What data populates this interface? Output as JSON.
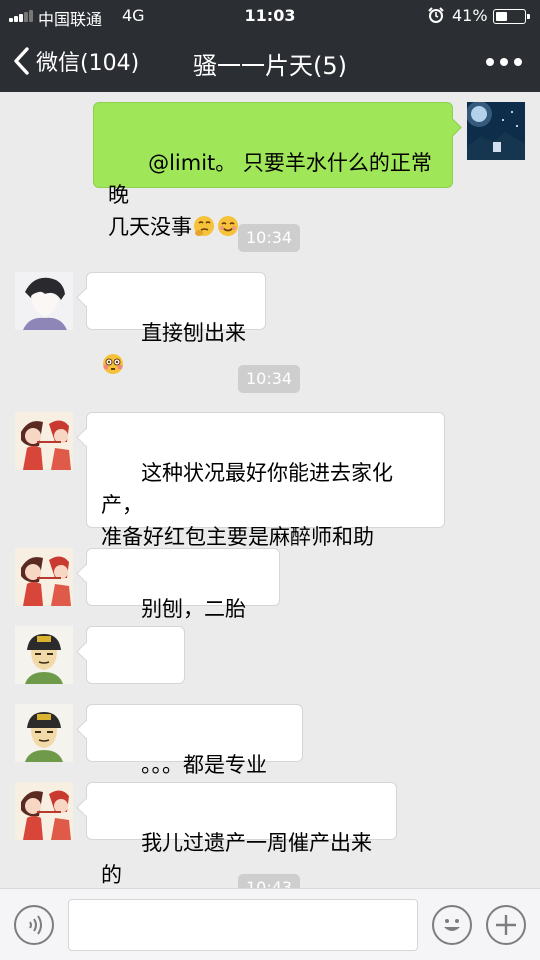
{
  "status_bar": {
    "carrier": "中国联通",
    "network": "4G",
    "time": "11:03",
    "battery": "41%",
    "battery_level": 0.41,
    "signal_bars": 3,
    "icons": [
      "signal-icon",
      "alarm-icon",
      "battery-icon"
    ]
  },
  "header": {
    "back_label": "微信(104)",
    "title": "骚一一片天(5)",
    "icons": [
      "chevron-left-icon",
      "more-icon"
    ]
  },
  "messages": [
    {
      "side": "right",
      "text": "@limit。 只要羊水什么的正常晚\n几天没事",
      "emoji": [
        "thinking-face-emoji",
        "smiling-face-emoji"
      ],
      "avatar": "night-sky-avatar"
    },
    {
      "type": "timestamp",
      "text": "10:34"
    },
    {
      "side": "left",
      "text": "直接刨出来",
      "emoji": [
        "flushed-face-emoji"
      ],
      "avatar": "anime-boy-avatar"
    },
    {
      "type": "timestamp",
      "text": "10:34"
    },
    {
      "side": "left",
      "text": "这种状况最好你能进去家化产，\n准备好红包主要是麻醉师和助\n产，接生的不必给",
      "avatar": "cartoon-girl-avatar"
    },
    {
      "side": "left",
      "text": "别刨，二胎费劲",
      "avatar": "cartoon-girl-avatar"
    },
    {
      "side": "left",
      "text": "。。。",
      "avatar": "cartoon-face-avatar"
    },
    {
      "side": "left",
      "text": "。。。都是专业的",
      "avatar": "cartoon-face-avatar"
    },
    {
      "side": "left",
      "text": "我儿过遗产一周催产出来的",
      "avatar": "cartoon-girl-avatar"
    },
    {
      "type": "timestamp",
      "text": "10:43"
    }
  ],
  "input_bar": {
    "text": "",
    "icons": [
      "voice-icon",
      "emoji-icon",
      "plus-icon"
    ]
  },
  "colors": {
    "header_bg": "#2b2e33",
    "chat_bg": "#ebebeb",
    "my_bubble": "#9fe658",
    "their_bubble": "#ffffff",
    "timestamp_bg": "#cecece"
  }
}
